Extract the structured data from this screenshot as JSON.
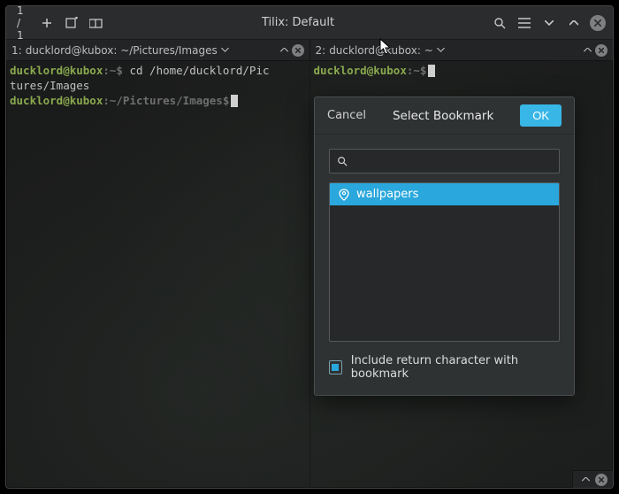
{
  "colors": {
    "accent": "#2aa7dc",
    "ok_button": "#38b6e6",
    "term_green": "#89a94e"
  },
  "titlebar": {
    "session_counter": "1 / 1",
    "title": "Tilix: Default"
  },
  "panes": {
    "left_tab": {
      "index": "1:",
      "label": "ducklord@kubox: ~/Pictures/Images"
    },
    "right_tab": {
      "index": "2:",
      "label": "ducklord@kubox: ~"
    }
  },
  "terminal_left": {
    "prompt1_user": "ducklord@kubox",
    "prompt1_path": ":~$",
    "cmd1": " cd /home/ducklord/Pic",
    "line2": "tures/Images",
    "prompt2_user": "ducklord@kubox",
    "prompt2_path": ":~/Pictures/Images$"
  },
  "terminal_right": {
    "prompt_user": "ducklord@kubox",
    "prompt_path": ":~$"
  },
  "dialog": {
    "cancel": "Cancel",
    "title": "Select Bookmark",
    "ok": "OK",
    "search_placeholder": "",
    "items": [
      "wallpapers"
    ],
    "checkbox_label": "Include return character with bookmark",
    "checkbox_checked": true
  }
}
